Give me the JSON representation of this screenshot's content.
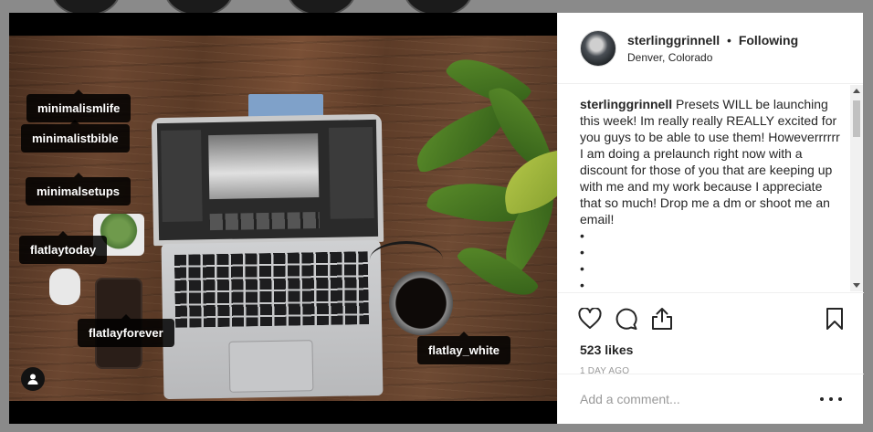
{
  "post": {
    "username": "sterlinggrinnell",
    "separator": "•",
    "follow_status": "Following",
    "location": "Denver, Colorado",
    "caption_username": "sterlinggrinnell",
    "caption_text": "Presets WILL be launching this week! Im really really REALLY excited for you guys to be able to use them! Howeverrrrrr I am doing a prelaunch right now with a discount for those of you that are keeping up with me and my work because I appreciate that so much! Drop me a dm or shoot me an email!",
    "bullets": [
      "•",
      "•",
      "•",
      "•"
    ],
    "likes": "523 likes",
    "time_ago": "1 DAY AGO",
    "comment_placeholder": "Add a comment..."
  },
  "tags": {
    "t1": "minimalismlife",
    "t2": "minimalistbible",
    "t3": "minimalsetups",
    "t4": "flatlaytoday",
    "t5": "flatlayforever",
    "t6": "flatlay_white"
  },
  "icons": {
    "like": "heart-icon",
    "comment": "comment-bubble-icon",
    "share": "share-icon",
    "save": "bookmark-icon",
    "more": "more-options-icon",
    "user_tags": "user-tag-icon"
  },
  "colors": {
    "text": "#262626",
    "muted": "#999999",
    "border": "#efefef",
    "tag_bg": "#000000"
  }
}
